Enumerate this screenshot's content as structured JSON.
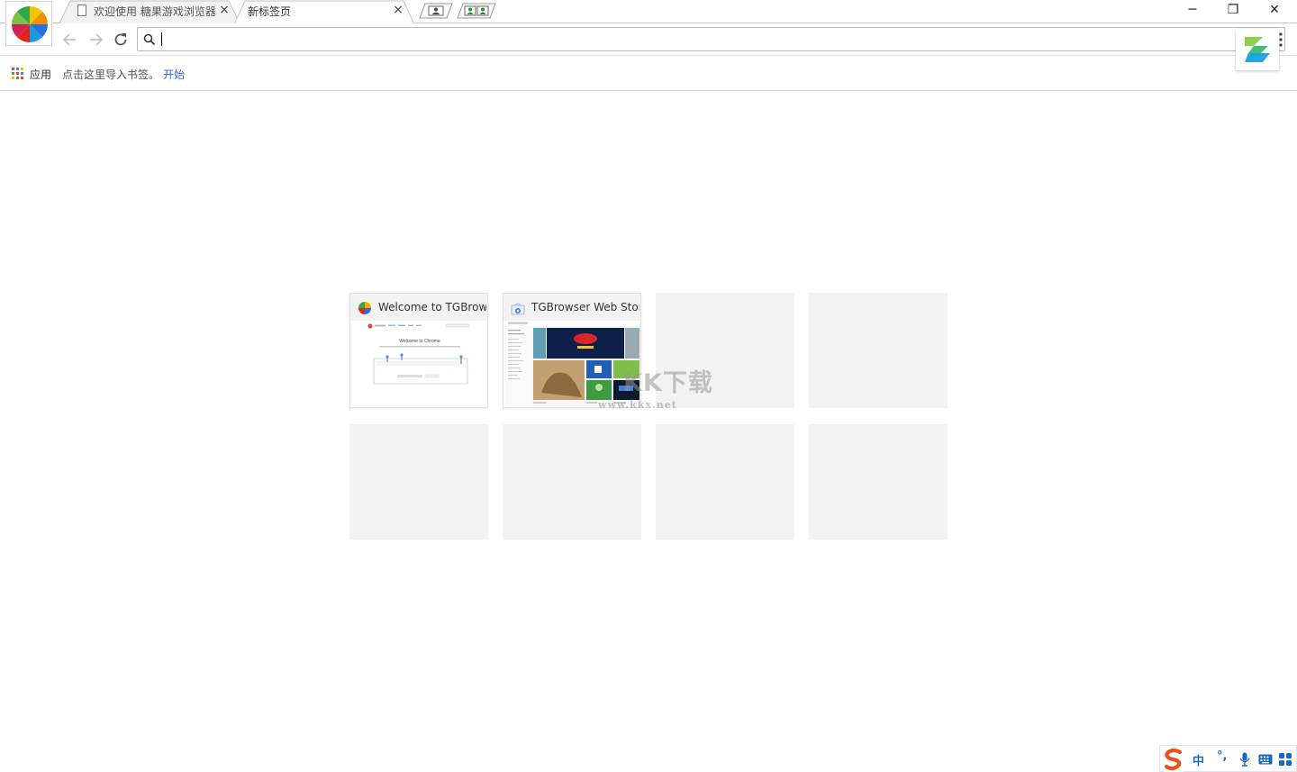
{
  "tabs": [
    {
      "title": "欢迎使用 糖果游戏浏览器",
      "close": "×"
    },
    {
      "title": "新标签页",
      "close": "×"
    }
  ],
  "window_controls": {
    "minimize": "─",
    "restore": "❐",
    "close": "✕"
  },
  "omnibox": {
    "value": "",
    "placeholder": ""
  },
  "bookmarks": {
    "apps_label": "应用",
    "hint": "点击这里导入书签。",
    "start_link": "开始"
  },
  "tiles": [
    {
      "title": "Welcome to TGBrowser",
      "thumb_heading": "Welcome to Chrome",
      "thumb_cta": "Get started"
    },
    {
      "title": "TGBrowser Web Store"
    }
  ],
  "watermark": {
    "text": "KK下载",
    "url": "www.kkx.net"
  },
  "ime": {
    "mode": "中",
    "punct": "°,",
    "mic": "mic-icon",
    "keyboard": "keyboard-icon",
    "grid": "grid-icon"
  },
  "colors": {
    "link": "#3367d6",
    "ime_blue": "#1a66c7",
    "tile_empty": "#f2f2f2"
  }
}
